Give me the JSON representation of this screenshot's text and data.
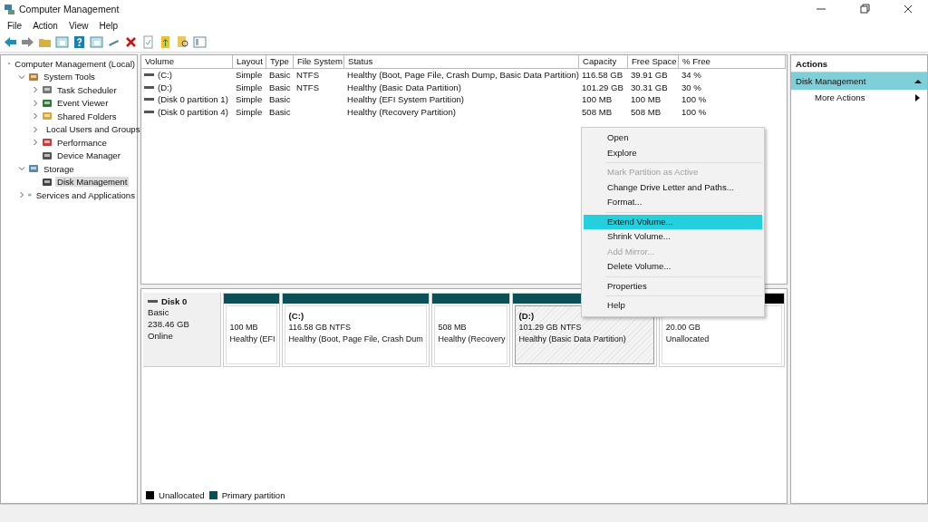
{
  "window": {
    "title": "Computer Management"
  },
  "menu": [
    "File",
    "Action",
    "View",
    "Help"
  ],
  "tree": [
    {
      "label": "Computer Management (Local)",
      "selected": false,
      "children": [
        {
          "label": "System Tools",
          "expanded": true,
          "selected": false,
          "children": [
            {
              "label": "Task Scheduler",
              "expanded": false,
              "selected": false
            },
            {
              "label": "Event Viewer",
              "expanded": false,
              "selected": false
            },
            {
              "label": "Shared Folders",
              "expanded": false,
              "selected": false
            },
            {
              "label": "Local Users and Groups",
              "expanded": false,
              "selected": false
            },
            {
              "label": "Performance",
              "expanded": false,
              "selected": false
            },
            {
              "label": "Device Manager",
              "selected": false
            }
          ]
        },
        {
          "label": "Storage",
          "expanded": true,
          "selected": false,
          "children": [
            {
              "label": "Disk Management",
              "selected": true
            }
          ]
        },
        {
          "label": "Services and Applications",
          "expanded": false,
          "selected": false
        }
      ]
    }
  ],
  "table": {
    "columns": [
      "Volume",
      "Layout",
      "Type",
      "File System",
      "Status",
      "Capacity",
      "Free Space",
      "% Free"
    ],
    "rows": [
      [
        "(C:)",
        "Simple",
        "Basic",
        "NTFS",
        "Healthy (Boot, Page File, Crash Dump, Basic Data Partition)",
        "116.58 GB",
        "39.91 GB",
        "34 %"
      ],
      [
        "(D:)",
        "Simple",
        "Basic",
        "NTFS",
        "Healthy (Basic Data Partition)",
        "101.29 GB",
        "30.31 GB",
        "30 %"
      ],
      [
        "(Disk 0 partition 1)",
        "Simple",
        "Basic",
        "",
        "Healthy (EFI System Partition)",
        "100 MB",
        "100 MB",
        "100 %"
      ],
      [
        "(Disk 0 partition 4)",
        "Simple",
        "Basic",
        "",
        "Healthy (Recovery Partition)",
        "508 MB",
        "508 MB",
        "100 %"
      ]
    ]
  },
  "disk": {
    "name": "Disk 0",
    "type": "Basic",
    "size": "238.46 GB",
    "status": "Online",
    "partitions": [
      {
        "kind": "primary",
        "size": "100 MB",
        "status": "Healthy (EFI",
        "selected": false
      },
      {
        "kind": "primary",
        "name": "(C:)",
        "size": "116.58 GB NTFS",
        "status": "Healthy (Boot, Page File, Crash Dum",
        "selected": false
      },
      {
        "kind": "primary",
        "size": "508 MB",
        "status": "Healthy (Recovery",
        "selected": false
      },
      {
        "kind": "primary",
        "name": "(D:)",
        "size": "101.29 GB NTFS",
        "status": "Healthy (Basic Data Partition)",
        "selected": true
      },
      {
        "kind": "unallocated",
        "size": "20.00 GB",
        "status": "Unallocated",
        "selected": false
      }
    ]
  },
  "legend": [
    {
      "label": "Unallocated",
      "color": "#000000"
    },
    {
      "label": "Primary partition",
      "color": "#0b5057"
    }
  ],
  "actions": {
    "title": "Actions",
    "section": "Disk Management",
    "items": [
      "More Actions"
    ]
  },
  "context_menu": [
    {
      "kind": "item",
      "label": "Open",
      "disabled": false,
      "selected": false
    },
    {
      "kind": "item",
      "label": "Explore",
      "disabled": false,
      "selected": false
    },
    {
      "kind": "separator"
    },
    {
      "kind": "item",
      "label": "Mark Partition as Active",
      "disabled": true,
      "selected": false
    },
    {
      "kind": "item",
      "label": "Change Drive Letter and Paths...",
      "disabled": false,
      "selected": false
    },
    {
      "kind": "item",
      "label": "Format...",
      "disabled": false,
      "selected": false
    },
    {
      "kind": "separator"
    },
    {
      "kind": "item",
      "label": "Extend Volume...",
      "disabled": false,
      "selected": true
    },
    {
      "kind": "item",
      "label": "Shrink Volume...",
      "disabled": false,
      "selected": false
    },
    {
      "kind": "item",
      "label": "Add Mirror...",
      "disabled": true,
      "selected": false
    },
    {
      "kind": "item",
      "label": "Delete Volume...",
      "disabled": false,
      "selected": false
    },
    {
      "kind": "separator"
    },
    {
      "kind": "item",
      "label": "Properties",
      "disabled": false,
      "selected": false
    },
    {
      "kind": "separator"
    },
    {
      "kind": "item",
      "label": "Help",
      "disabled": false,
      "selected": false
    }
  ]
}
